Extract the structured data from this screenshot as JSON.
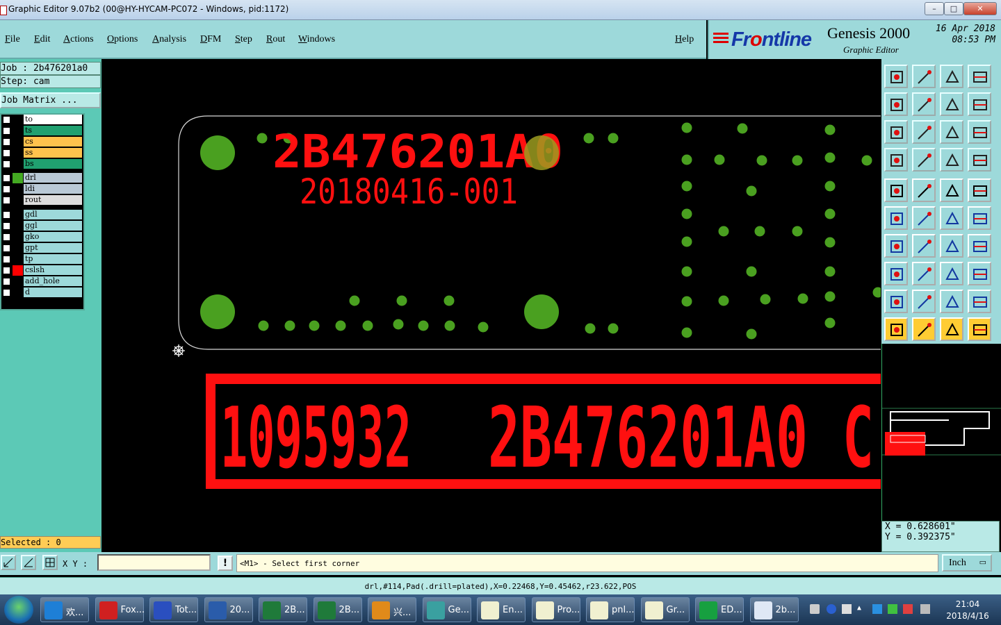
{
  "window": {
    "title": "Graphic Editor 9.07b2 (00@HY-HYCAM-PC072 - Windows, pid:1172)",
    "minimize": "–",
    "maximize": "□",
    "close": "✕"
  },
  "menu": {
    "items": [
      "File",
      "Edit",
      "Actions",
      "Options",
      "Analysis",
      "DFM",
      "Step",
      "Rout",
      "Windows"
    ],
    "help": "Help"
  },
  "logo": {
    "brand_pre": "Fr",
    "brand_o": "o",
    "brand_post": "ntline",
    "product": "Genesis 2000",
    "subtitle": "Graphic Editor",
    "date": "16 Apr 2018",
    "time": "08:53 PM"
  },
  "job": {
    "job": "Job : 2b476201a0",
    "step": "Step: cam",
    "matrix_button": "Job Matrix ..."
  },
  "layers": [
    {
      "name": "to",
      "color": "#ffffff",
      "swatch": "#000000"
    },
    {
      "name": "ts",
      "color": "#20a070",
      "swatch": "#000000"
    },
    {
      "name": "cs",
      "color": "#ffc24d",
      "swatch": "#000000"
    },
    {
      "name": "ss",
      "color": "#ffc24d",
      "swatch": "#000000"
    },
    {
      "name": "bs",
      "color": "#20a070",
      "swatch": "#000000"
    },
    {
      "name": "drl",
      "color": "#b9c9d6",
      "swatch": "#44aa22"
    },
    {
      "name": "ldi",
      "color": "#b9c9d6",
      "swatch": "#000000"
    },
    {
      "name": "rout",
      "color": "#dddddd",
      "swatch": "#000000"
    },
    {
      "name": "gdl",
      "color": "#9dd9da",
      "swatch": "#000000"
    },
    {
      "name": "ggl",
      "color": "#9dd9da",
      "swatch": "#000000"
    },
    {
      "name": "gko",
      "color": "#9dd9da",
      "swatch": "#000000"
    },
    {
      "name": "gpt",
      "color": "#9dd9da",
      "swatch": "#000000"
    },
    {
      "name": "tp",
      "color": "#9dd9da",
      "swatch": "#000000"
    },
    {
      "name": "cslsh",
      "color": "#9dd9da",
      "swatch": "#ff0000"
    },
    {
      "name": "add_hole",
      "color": "#9dd9da",
      "swatch": "#000000"
    },
    {
      "name": "d",
      "color": "#9dd9da",
      "swatch": "#000000"
    }
  ],
  "selected": "Selected : 0",
  "canvas": {
    "text1": "2B476201A0",
    "text2": "20180416-001",
    "big_num": "1095932",
    "big_code": "2B476201A0",
    "big_c": "C"
  },
  "coords": {
    "x": "X = 0.628601\"",
    "y": "Y = 0.392375\""
  },
  "command": {
    "xy_label": "X Y :",
    "excl": "!",
    "prompt": "<M1> - Select first corner",
    "unit": "Inch"
  },
  "status": "drl,#114,Pad(.drill=plated),X=0.22468,Y=0.45462,r23.622,POS",
  "taskbar": {
    "items": [
      {
        "label": "欢...",
        "color": "#1e7fd6"
      },
      {
        "label": "Fox...",
        "color": "#d02020"
      },
      {
        "label": "Tot...",
        "color": "#2a4fbf"
      },
      {
        "label": "20...",
        "color": "#2a5caa"
      },
      {
        "label": "2B...",
        "color": "#1f7a3a"
      },
      {
        "label": "2B...",
        "color": "#1f7a3a"
      },
      {
        "label": "兴...",
        "color": "#e08a1a"
      },
      {
        "label": "Ge...",
        "color": "#3aa0a0"
      },
      {
        "label": "En...",
        "color": "#f0f0d0"
      },
      {
        "label": "Pro...",
        "color": "#f0f0d0"
      },
      {
        "label": "pnl...",
        "color": "#f0f0d0"
      },
      {
        "label": "Gr...",
        "color": "#f0f0d0"
      },
      {
        "label": "ED...",
        "color": "#17a040"
      },
      {
        "label": "2b...",
        "color": "#dfe8f5"
      }
    ],
    "time": "21:04",
    "date": "2018/4/16"
  }
}
